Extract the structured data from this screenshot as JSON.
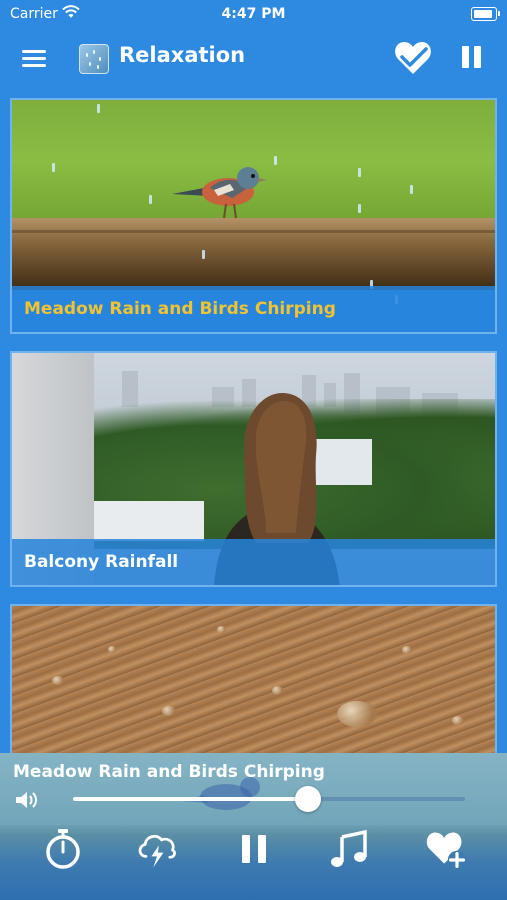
{
  "status_bar": {
    "carrier": "Carrier",
    "time": "4:47 PM"
  },
  "nav": {
    "title": "Relaxation",
    "icons": [
      "menu-icon",
      "heart-checkmark-icon",
      "pause-icon"
    ]
  },
  "cards": [
    {
      "title": "Meadow Rain and Birds Chirping",
      "title_color": "#f2c230"
    },
    {
      "title": "Balcony Rainfall",
      "title_color": "#ffffff"
    },
    {
      "title": ""
    }
  ],
  "player": {
    "now_playing": "Meadow Rain and Birds Chirping",
    "volume_level": 0.6,
    "tabs": [
      "timer-icon",
      "cloud-lightning-icon",
      "pause-icon",
      "music-note-icon",
      "heart-add-icon"
    ]
  },
  "colors": {
    "accent": "#2e8ae0",
    "card_border": "#6fb2ee",
    "featured_title": "#f2c230"
  }
}
